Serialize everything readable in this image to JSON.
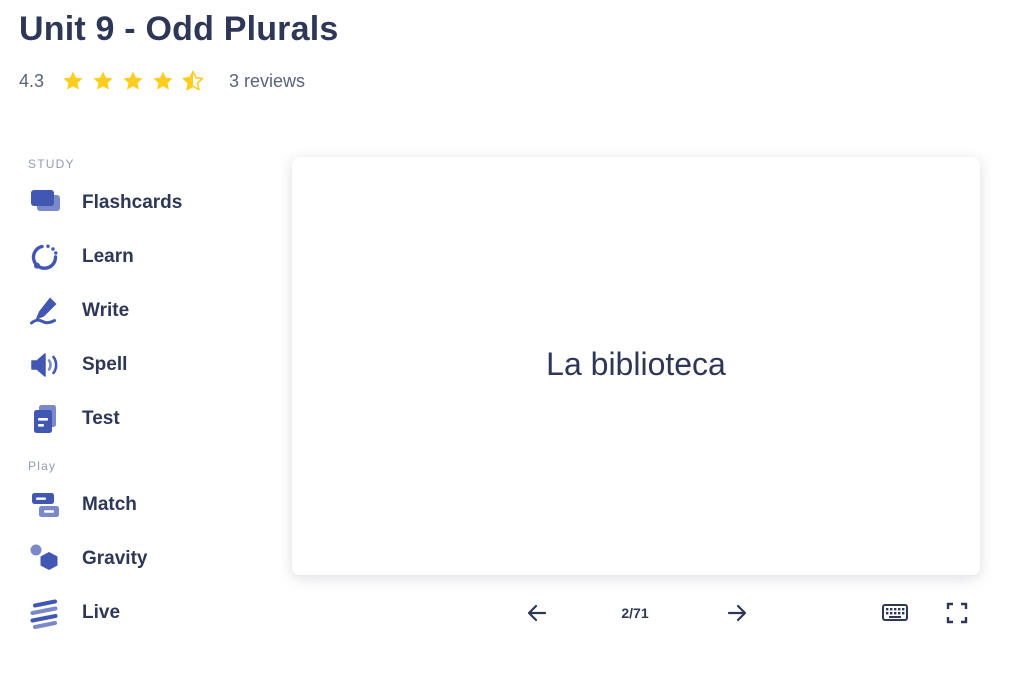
{
  "header": {
    "title": "Unit 9 - Odd Plurals",
    "rating_value": "4.3",
    "rating_stars": 4.3,
    "star_color": "#ffcd1f",
    "reviews": "3 reviews"
  },
  "sidebar": {
    "study_label": "STUDY",
    "study_items": [
      {
        "label": "Flashcards",
        "icon": "flashcards-icon"
      },
      {
        "label": "Learn",
        "icon": "learn-icon"
      },
      {
        "label": "Write",
        "icon": "write-icon"
      },
      {
        "label": "Spell",
        "icon": "spell-icon"
      },
      {
        "label": "Test",
        "icon": "test-icon"
      }
    ],
    "play_label": "Play",
    "play_items": [
      {
        "label": "Match",
        "icon": "match-icon"
      },
      {
        "label": "Gravity",
        "icon": "gravity-icon"
      },
      {
        "label": "Live",
        "icon": "live-icon"
      }
    ],
    "accent_color": "#4257b2"
  },
  "card": {
    "term": "La biblioteca"
  },
  "controls": {
    "counter": "2/71",
    "prev_icon": "arrow-left-icon",
    "next_icon": "arrow-right-icon",
    "keyboard_icon": "keyboard-icon",
    "fullscreen_icon": "fullscreen-icon"
  }
}
